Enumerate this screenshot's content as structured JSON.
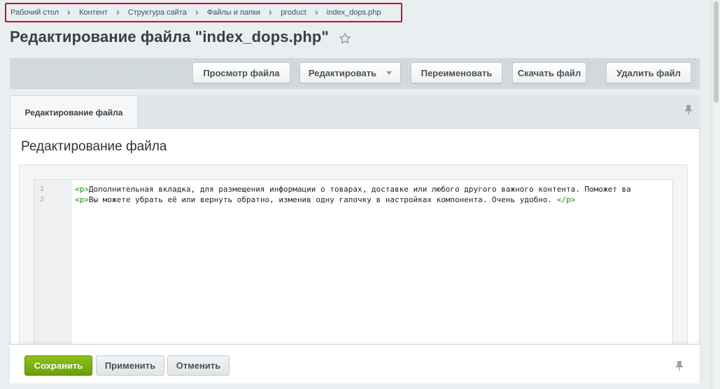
{
  "breadcrumb": {
    "items": [
      "Рабочий стол",
      "Контент",
      "Структура сайта",
      "Файлы и папки",
      "product",
      "index_dops.php"
    ]
  },
  "header": {
    "title": "Редактирование файла \"index_dops.php\"",
    "favorite_icon": "star-outline-icon"
  },
  "toolbar": {
    "view_label": "Просмотр файла",
    "edit_label": "Редактировать",
    "rename_label": "Переименовать",
    "download_label": "Скачать файл",
    "delete_label": "Удалить файл"
  },
  "tabs": [
    {
      "label": "Редактирование файла",
      "active": true
    }
  ],
  "panel": {
    "heading": "Редактирование файла"
  },
  "editor": {
    "line_numbers": [
      "1",
      "2"
    ],
    "lines": [
      {
        "open_tag": "<p>",
        "text": "Дополнительная вкладка, для размещения информации о товарах, доставке или любого другого важного контента. Поможет ва",
        "close_tag": ""
      },
      {
        "open_tag": "<p>",
        "text": "Вы можете убрать её или вернуть обратно, изменив одну галочку в настройках компонента. Очень удобно. ",
        "close_tag": "</p>"
      }
    ]
  },
  "footer": {
    "save_label": "Сохранить",
    "apply_label": "Применить",
    "cancel_label": "Отменить"
  },
  "colors": {
    "accent_green": "#7ab20f",
    "breadcrumb_highlight": "#c8102e",
    "code_tag": "#1b8a1b"
  }
}
